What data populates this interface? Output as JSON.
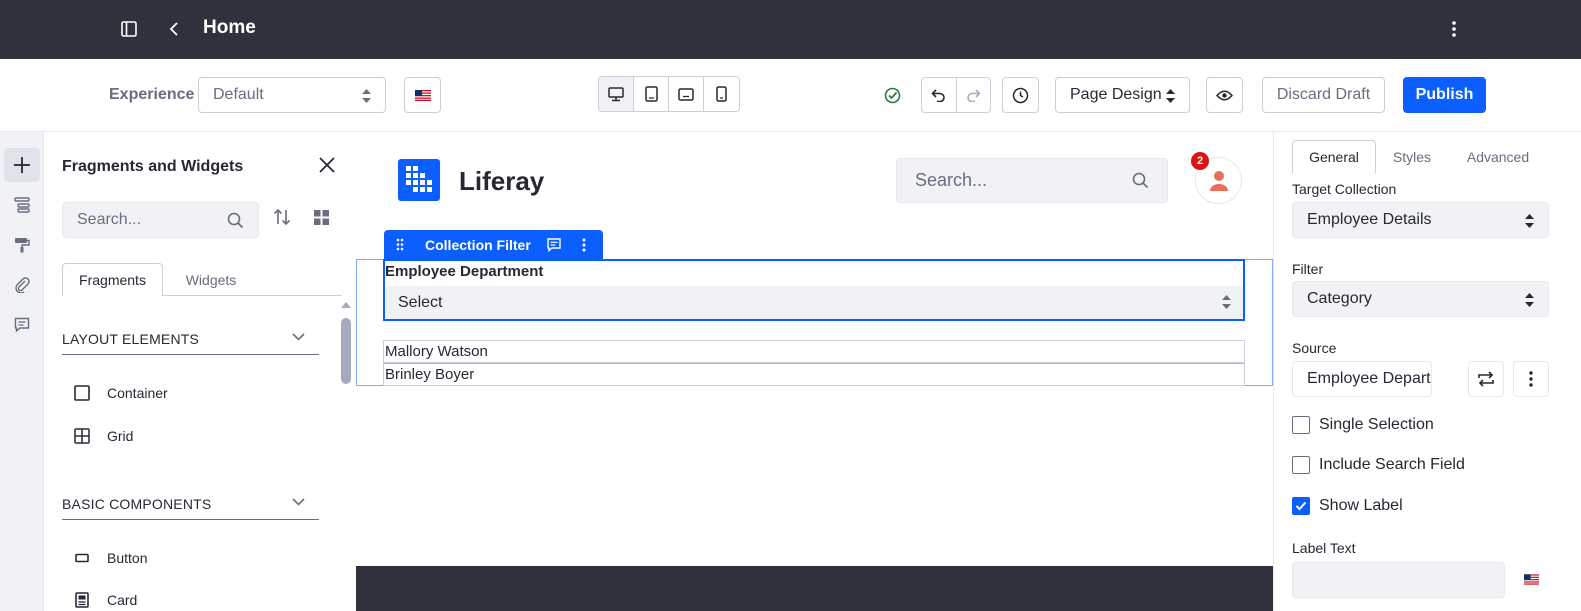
{
  "topbar": {
    "title": "Home"
  },
  "toolbar": {
    "experience_label": "Experience",
    "experience_value": "Default",
    "page_design_label": "Page Design",
    "discard_label": "Discard Draft",
    "publish_label": "Publish"
  },
  "fragments_panel": {
    "title": "Fragments and Widgets",
    "search_placeholder": "Search...",
    "tabs": [
      {
        "label": "Fragments"
      },
      {
        "label": "Widgets"
      }
    ],
    "sections": [
      {
        "label": "LAYOUT ELEMENTS",
        "items": [
          {
            "label": "Container"
          },
          {
            "label": "Grid"
          }
        ]
      },
      {
        "label": "BASIC COMPONENTS",
        "items": [
          {
            "label": "Button"
          },
          {
            "label": "Card"
          }
        ]
      }
    ]
  },
  "canvas": {
    "brand": "Liferay",
    "search_placeholder": "Search...",
    "notification_count": "2",
    "fragment_label": "Collection Filter",
    "filter_label": "Employee Department",
    "filter_select_value": "Select",
    "rows": [
      {
        "text": "Mallory Watson"
      },
      {
        "text": "Brinley Boyer"
      }
    ]
  },
  "config_panel": {
    "tabs": [
      {
        "label": "General"
      },
      {
        "label": "Styles"
      },
      {
        "label": "Advanced"
      }
    ],
    "target_collection_label": "Target Collection",
    "target_collection_value": "Employee Details",
    "filter_label": "Filter",
    "filter_value": "Category",
    "source_label": "Source",
    "source_value": "Employee Depart...",
    "single_selection_label": "Single Selection",
    "include_search_label": "Include Search Field",
    "show_label_label": "Show Label",
    "label_text_label": "Label Text",
    "single_selection_checked": false,
    "include_search_checked": false,
    "show_label_checked": true
  },
  "colors": {
    "primary": "#0b5fff",
    "topbar": "#2f313d",
    "success": "#287d3c"
  }
}
